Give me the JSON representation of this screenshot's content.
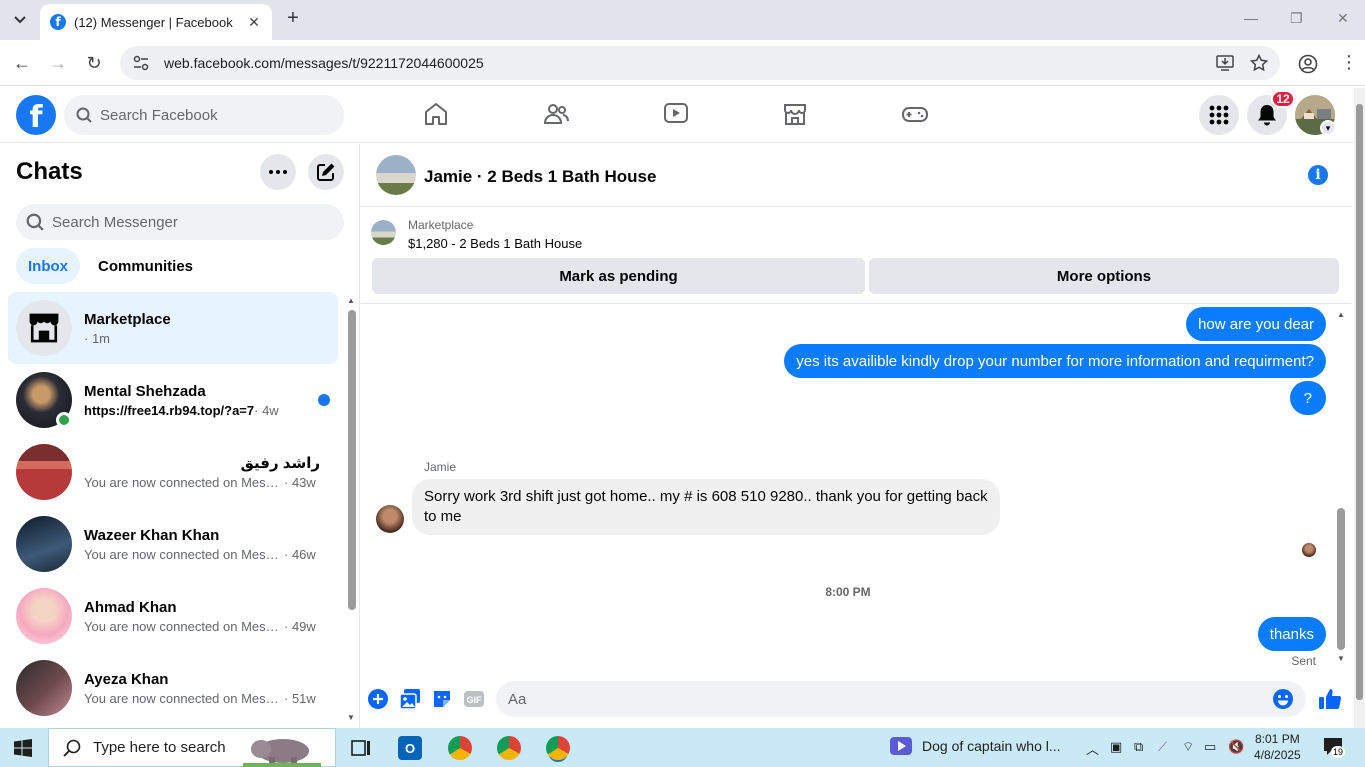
{
  "browser": {
    "tab_title": "(12) Messenger | Facebook",
    "url": "web.facebook.com/messages/t/9221172044600025"
  },
  "fb": {
    "search_placeholder": "Search Facebook",
    "notification_count": "12",
    "brand_color": "#1877f2"
  },
  "sidebar": {
    "title": "Chats",
    "search_placeholder": "Search Messenger",
    "tabs": [
      {
        "label": "Inbox",
        "active": true
      },
      {
        "label": "Communities",
        "active": false
      }
    ],
    "chats": [
      {
        "name": "Marketplace",
        "snippet": "",
        "time": "· 1m",
        "active": true,
        "icon": "store-icon"
      },
      {
        "name": "Mental Shehzada",
        "snippet": "https://free14.rb94.top/?a=7",
        "time": " · 4w",
        "unread": true,
        "online": true
      },
      {
        "name": "راشد رفیق",
        "snippet": "You are now connected on Messe...",
        "time": " · 43w"
      },
      {
        "name": "Wazeer Khan Khan",
        "snippet": "You are now connected on Messe...",
        "time": " · 46w"
      },
      {
        "name": "Ahmad Khan",
        "snippet": "You are now connected on Messe...",
        "time": " · 49w"
      },
      {
        "name": "Ayeza Khan",
        "snippet": "You are now connected on Messe...",
        "time": " · 51w"
      }
    ]
  },
  "conversation": {
    "title": "Jamie · 2 Beds 1 Bath House",
    "marketplace_label": "Marketplace",
    "listing": "$1,280 - 2 Beds 1 Bath House",
    "mark_pending": "Mark as pending",
    "more_options": "More options",
    "messages_out_top": [
      "how are you dear",
      "yes its availible kindly drop your number for more information and requirment?",
      "?"
    ],
    "sender": "Jamie",
    "incoming": "Sorry work 3rd shift just got home.. my # is 608 510 9280.. thank you for getting back to me",
    "timestamp": "8:00 PM",
    "last_out": "thanks",
    "status": "Sent",
    "composer_placeholder": "Aa",
    "bubble_color": "#0a7cff"
  },
  "taskbar": {
    "search_placeholder": "Type here to search",
    "media_title": "Dog of captain who l...",
    "time": "8:01 PM",
    "date": "4/8/2025",
    "notif_count": "19"
  }
}
